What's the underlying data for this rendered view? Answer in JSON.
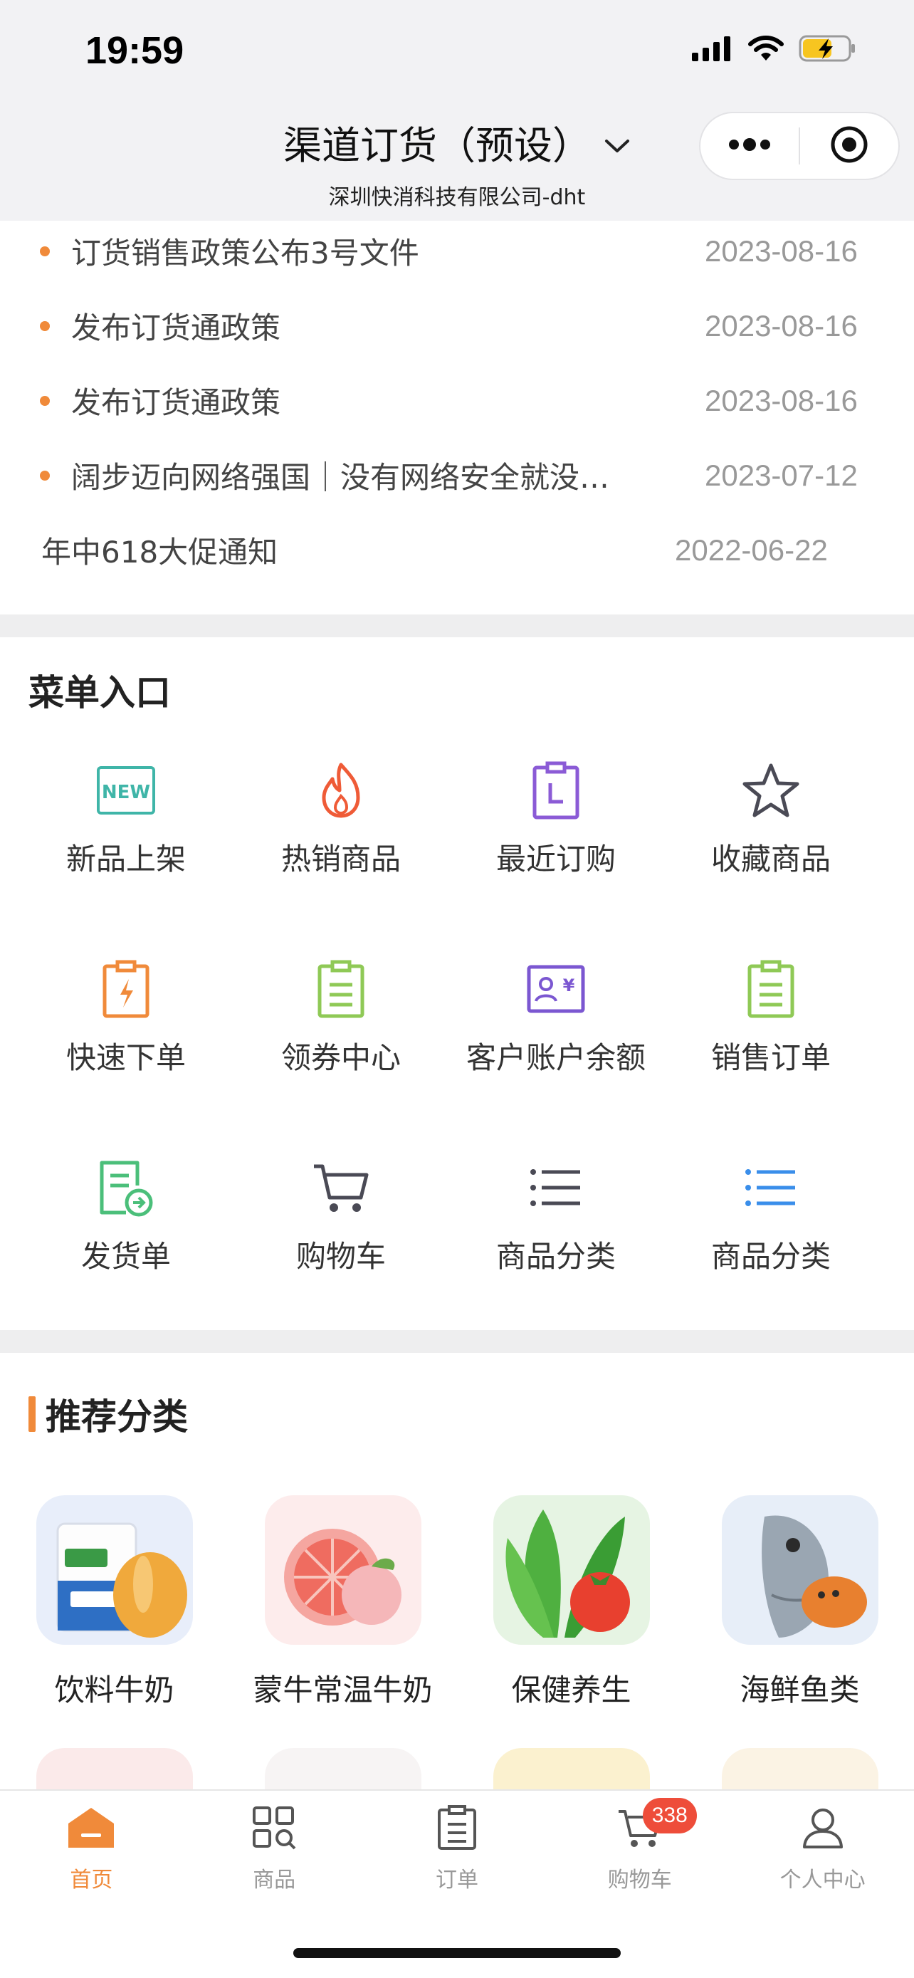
{
  "status_bar": {
    "time": "19:59"
  },
  "nav": {
    "title": "渠道订货（预设）",
    "subtitle": "深圳快消科技有限公司-dht"
  },
  "notices": [
    {
      "title": "订货销售政策公布3号文件",
      "date": "2023-08-16",
      "dot": true
    },
    {
      "title": "发布订货通政策",
      "date": "2023-08-16",
      "dot": true
    },
    {
      "title": "发布订货通政策",
      "date": "2023-08-16",
      "dot": true
    },
    {
      "title": "阔步迈向网络强国｜没有网络安全就没…",
      "date": "2023-07-12",
      "dot": true
    },
    {
      "title": "年中618大促通知",
      "date": "2022-06-22",
      "dot": false
    }
  ],
  "menu": {
    "title": "菜单入口",
    "items": [
      {
        "label": "新品上架",
        "icon": "new-badge-icon",
        "color": "#3fb5a8"
      },
      {
        "label": "热销商品",
        "icon": "fire-icon",
        "color": "#ef5b37"
      },
      {
        "label": "最近订购",
        "icon": "recent-clipboard-icon",
        "color": "#8b5bd6"
      },
      {
        "label": "收藏商品",
        "icon": "star-icon",
        "color": "#4a4a55"
      },
      {
        "label": "快速下单",
        "icon": "lightning-clipboard-icon",
        "color": "#f08a3a"
      },
      {
        "label": "领券中心",
        "icon": "coupon-clipboard-icon",
        "color": "#8fc956"
      },
      {
        "label": "客户账户余额",
        "icon": "account-balance-icon",
        "color": "#7b57d1"
      },
      {
        "label": "销售订单",
        "icon": "sales-order-icon",
        "color": "#8fc956"
      },
      {
        "label": "发货单",
        "icon": "delivery-note-icon",
        "color": "#4bbf7a"
      },
      {
        "label": "购物车",
        "icon": "cart-icon",
        "color": "#4a4a55"
      },
      {
        "label": "商品分类",
        "icon": "list-icon",
        "color": "#4a4a55"
      },
      {
        "label": "商品分类",
        "icon": "list-icon",
        "color": "#3a8eea"
      }
    ]
  },
  "recommend": {
    "title": "推荐分类",
    "items": [
      {
        "label": "饮料牛奶",
        "icon": "milk-bread-image"
      },
      {
        "label": "蒙牛常温牛奶",
        "icon": "grapefruit-peach-image"
      },
      {
        "label": "保健养生",
        "icon": "vegetable-tomato-image"
      },
      {
        "label": "海鲜鱼类",
        "icon": "fish-crab-image"
      }
    ]
  },
  "tabbar": {
    "items": [
      {
        "label": "首页",
        "icon": "home-icon",
        "active": true
      },
      {
        "label": "商品",
        "icon": "grid-search-icon",
        "active": false
      },
      {
        "label": "订单",
        "icon": "order-icon",
        "active": false
      },
      {
        "label": "购物车",
        "icon": "cart-icon",
        "active": false,
        "badge": "338"
      },
      {
        "label": "个人中心",
        "icon": "person-icon",
        "active": false
      }
    ]
  },
  "colors": {
    "accent": "#f08a3a",
    "badge": "#ee4d3a",
    "divider": "#eeeeef"
  }
}
